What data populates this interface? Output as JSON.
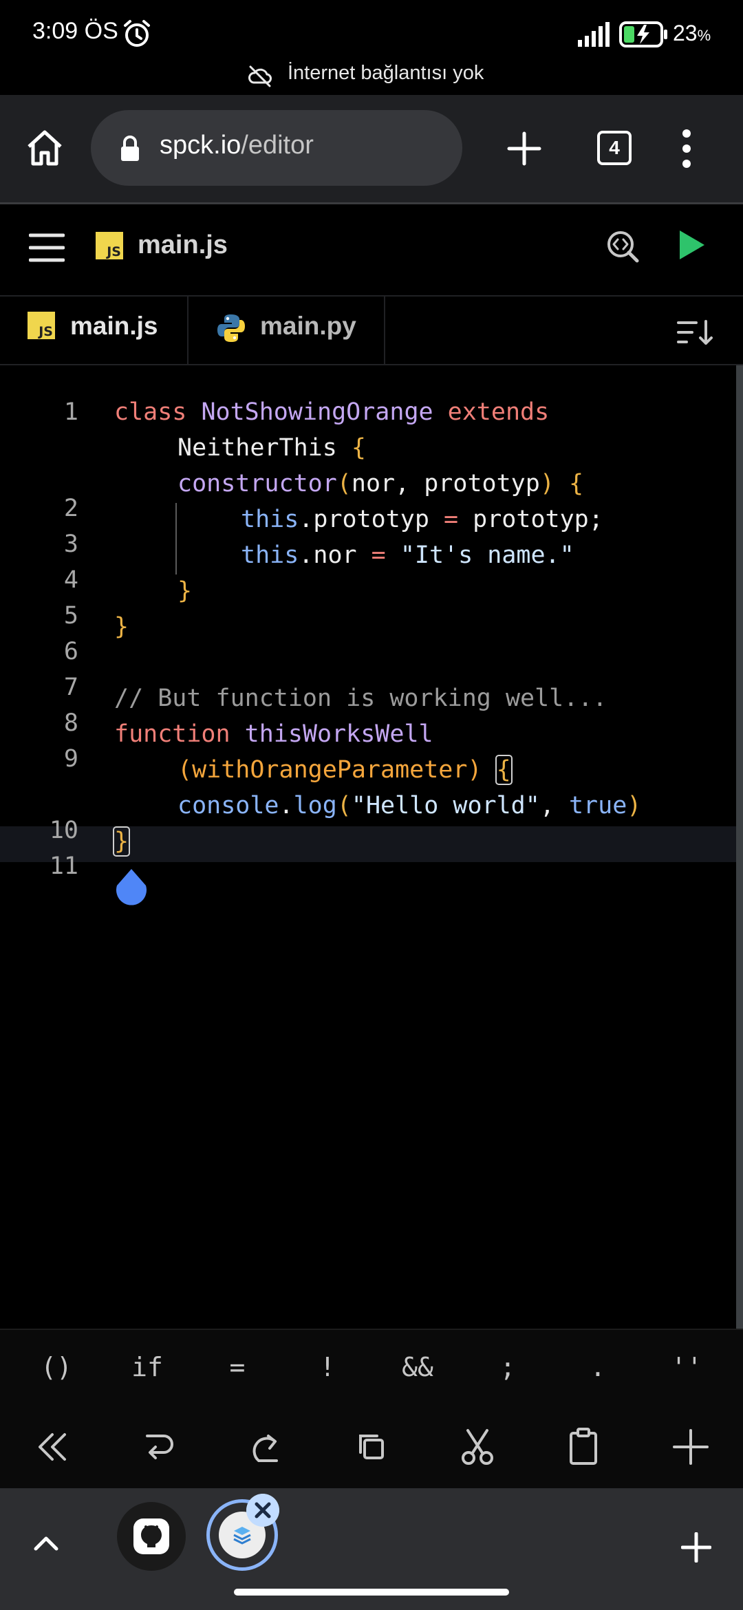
{
  "status": {
    "time": "3:09 ÖS",
    "battery": "23",
    "battery_unit": "%"
  },
  "offline_banner": "İnternet bağlantısı yok",
  "browser": {
    "url_domain": "spck.io",
    "url_path": "/editor",
    "tab_count": "4"
  },
  "app": {
    "title": "main.js",
    "js_badge": "JS"
  },
  "tabs": [
    {
      "label": "main.js"
    },
    {
      "label": "main.py"
    }
  ],
  "editor": {
    "line_numbers": [
      "1",
      "2",
      "3",
      "4",
      "5",
      "6",
      "7",
      "8",
      "9",
      "10",
      "11"
    ],
    "lines": [
      {
        "parts": [
          {
            "t": "class ",
            "c": "kw"
          },
          {
            "t": "NotShowingOrange",
            "c": "cls"
          },
          {
            "t": " extends",
            "c": "kw"
          }
        ]
      },
      {
        "parts": [
          {
            "t": "NeitherThis ",
            "c": ""
          },
          {
            "t": "{",
            "c": "br"
          }
        ]
      },
      {
        "parts": [
          {
            "t": "constructor",
            "c": "cls"
          },
          {
            "t": "(",
            "c": "br"
          },
          {
            "t": "nor, prototyp",
            "c": ""
          },
          {
            "t": ")",
            "c": "br"
          },
          {
            "t": " ",
            "c": ""
          },
          {
            "t": "{",
            "c": "br"
          }
        ]
      },
      {
        "parts": [
          {
            "t": "this",
            "c": "ths"
          },
          {
            "t": ".prototyp ",
            "c": ""
          },
          {
            "t": "=",
            "c": "kw"
          },
          {
            "t": " prototyp;",
            "c": ""
          }
        ]
      },
      {
        "parts": [
          {
            "t": "this",
            "c": "ths"
          },
          {
            "t": ".nor ",
            "c": ""
          },
          {
            "t": "=",
            "c": "kw"
          },
          {
            "t": " ",
            "c": ""
          },
          {
            "t": "\"It's name.\"",
            "c": "str"
          }
        ]
      },
      {
        "parts": [
          {
            "t": "}",
            "c": "br"
          }
        ]
      },
      {
        "parts": [
          {
            "t": "}",
            "c": "br"
          }
        ]
      },
      {
        "parts": [
          {
            "t": "// But function is working well...",
            "c": "cmt"
          }
        ]
      },
      {
        "parts": [
          {
            "t": "function ",
            "c": "kw"
          },
          {
            "t": "thisWorksWell",
            "c": "cls"
          }
        ]
      },
      {
        "parts": [
          {
            "t": "(withOrangeParameter)",
            "c": "par"
          },
          {
            "t": " ",
            "c": ""
          },
          {
            "t": "{",
            "c": "br boxed"
          }
        ]
      },
      {
        "parts": [
          {
            "t": "console",
            "c": "ths"
          },
          {
            "t": ".",
            "c": ""
          },
          {
            "t": "log",
            "c": "ths"
          },
          {
            "t": "(",
            "c": "br"
          },
          {
            "t": "\"Hello world\"",
            "c": "str"
          },
          {
            "t": ", ",
            "c": ""
          },
          {
            "t": "true",
            "c": "ths"
          },
          {
            "t": ")",
            "c": "br"
          }
        ]
      },
      {
        "parts": [
          {
            "t": "}",
            "c": "br boxed"
          }
        ]
      }
    ]
  },
  "extra_keys": [
    "()",
    "if",
    "=",
    "!",
    "&&",
    ";",
    ".",
    "''"
  ],
  "toolbar": [
    "double-chevron-left-icon",
    "undo-icon",
    "redo-icon",
    "copy-icon",
    "cut-icon",
    "paste-icon",
    "add-icon"
  ]
}
